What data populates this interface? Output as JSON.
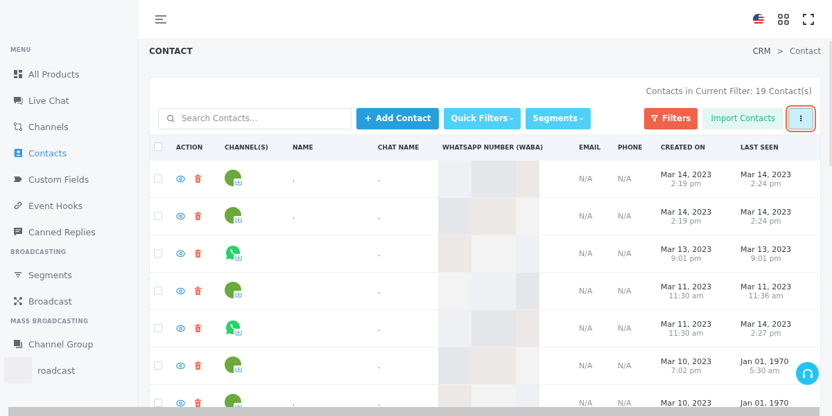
{
  "sidebar": {
    "sections": [
      {
        "heading": "MENU",
        "items": [
          {
            "label": "All Products",
            "selected": false
          },
          {
            "label": "Live Chat",
            "selected": false
          },
          {
            "label": "Channels",
            "selected": false
          },
          {
            "label": "Contacts",
            "selected": true
          },
          {
            "label": "Custom Fields",
            "selected": false
          },
          {
            "label": "Event Hooks",
            "selected": false
          },
          {
            "label": "Canned Replies",
            "selected": false
          }
        ]
      },
      {
        "heading": "BROADCASTING",
        "items": [
          {
            "label": "Segments",
            "selected": false
          },
          {
            "label": "Broadcast",
            "selected": false
          }
        ]
      },
      {
        "heading": "MASS BROADCASTING",
        "items": [
          {
            "label": "Channel Group",
            "selected": false
          },
          {
            "label": "roadcast",
            "selected": false
          }
        ]
      }
    ]
  },
  "page": {
    "title": "CONTACT",
    "breadcrumb": [
      "CRM",
      "Contact"
    ],
    "separator": ">"
  },
  "toolbar": {
    "count_text": "Contacts in Current Filter: 19 Contact(s)",
    "search": {
      "placeholder": "Search Contacts..."
    },
    "buttons": [
      {
        "label": "Add Contact",
        "kind": "primary"
      },
      {
        "label": "Quick Filters",
        "kind": "dropdown"
      },
      {
        "label": "Segments",
        "kind": "dropdown"
      },
      {
        "label": "Filters",
        "kind": "danger"
      },
      {
        "label": "Import Contacts",
        "kind": "soft"
      },
      {
        "label": "⋮",
        "kind": "more"
      }
    ]
  },
  "table": {
    "select_all_checked": false,
    "columns": [
      "ACTION",
      "CHANNEL(S)",
      "NAME",
      "CHAT NAME",
      "WHATSAPP NUMBER (WABA)",
      "EMAIL",
      "PHONE",
      "CREATED ON",
      "LAST SEEN"
    ],
    "rows": [
      {
        "checked": false,
        "kind": "avatar",
        "name": ".",
        "chat_name": ".",
        "email": "N/A",
        "phone": "N/A",
        "created": [
          "Mar 14, 2023",
          "2:19 pm"
        ],
        "last_seen": [
          "Mar 14, 2023",
          "2:24 pm"
        ]
      },
      {
        "checked": false,
        "kind": "avatar",
        "name": ".",
        "chat_name": ".",
        "email": "N/A",
        "phone": "N/A",
        "created": [
          "Mar 14, 2023",
          "2:19 pm"
        ],
        "last_seen": [
          "Mar 14, 2023",
          "2:24 pm"
        ]
      },
      {
        "checked": false,
        "kind": "whatsapp",
        "chat_name": ".",
        "email": "N/A",
        "phone": "N/A",
        "created": [
          "Mar 13, 2023",
          "9:01 pm"
        ],
        "last_seen": [
          "Mar 13, 2023",
          "9:01 pm"
        ]
      },
      {
        "checked": false,
        "kind": "avatar",
        "chat_name": ".",
        "email": "N/A",
        "phone": "N/A",
        "created": [
          "Mar 11, 2023",
          "11:30 am"
        ],
        "last_seen": [
          "Mar 11, 2023",
          "11:36 am"
        ]
      },
      {
        "checked": false,
        "kind": "whatsapp",
        "chat_name": ".",
        "email": "N/A",
        "phone": "N/A",
        "created": [
          "Mar 11, 2023",
          "11:30 am"
        ],
        "last_seen": [
          "Mar 14, 2023",
          "2:27 pm"
        ]
      },
      {
        "checked": false,
        "kind": "avatar",
        "chat_name": ".",
        "email": "N/A",
        "phone": "N/A",
        "created": [
          "Mar 10, 2023",
          "7:02 pm"
        ],
        "last_seen": [
          "Jan 01, 1970",
          "5:30 am"
        ]
      },
      {
        "checked": false,
        "kind": "avatar",
        "name": ".",
        "chat_name": ".",
        "email": "N/A",
        "phone": "N/A",
        "created": [
          "Mar 10, 2023"
        ],
        "last_seen": [
          "Jan 01, 1970"
        ]
      }
    ]
  }
}
